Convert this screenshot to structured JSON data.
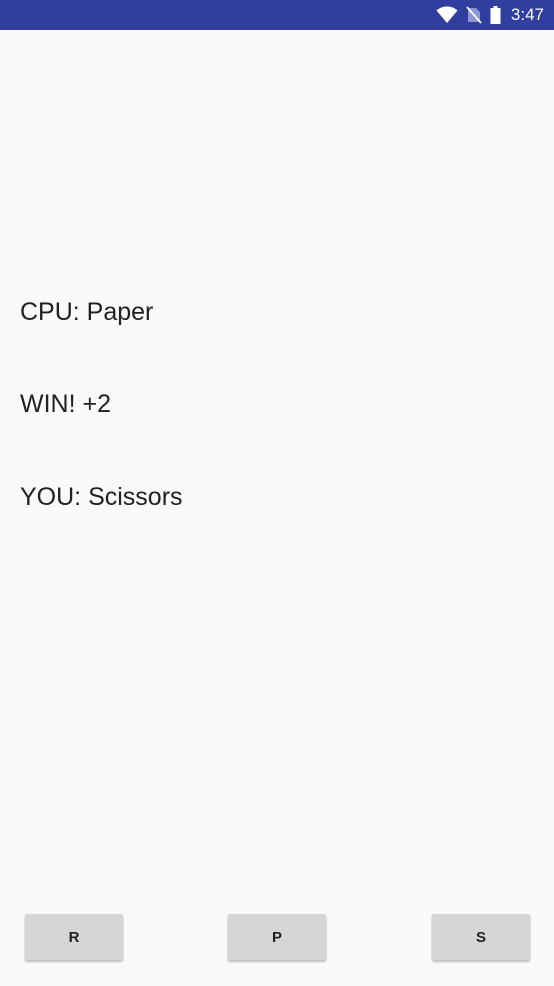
{
  "status_bar": {
    "time": "3:47",
    "icons": [
      "wifi-icon",
      "no-sim-icon",
      "battery-icon"
    ],
    "background": "#303f9f"
  },
  "game": {
    "cpu_text": "CPU: Paper",
    "result_text": "WIN! +2",
    "you_text": "YOU: Scissors"
  },
  "buttons": {
    "rock_label": "R",
    "paper_label": "P",
    "scissors_label": "S"
  }
}
